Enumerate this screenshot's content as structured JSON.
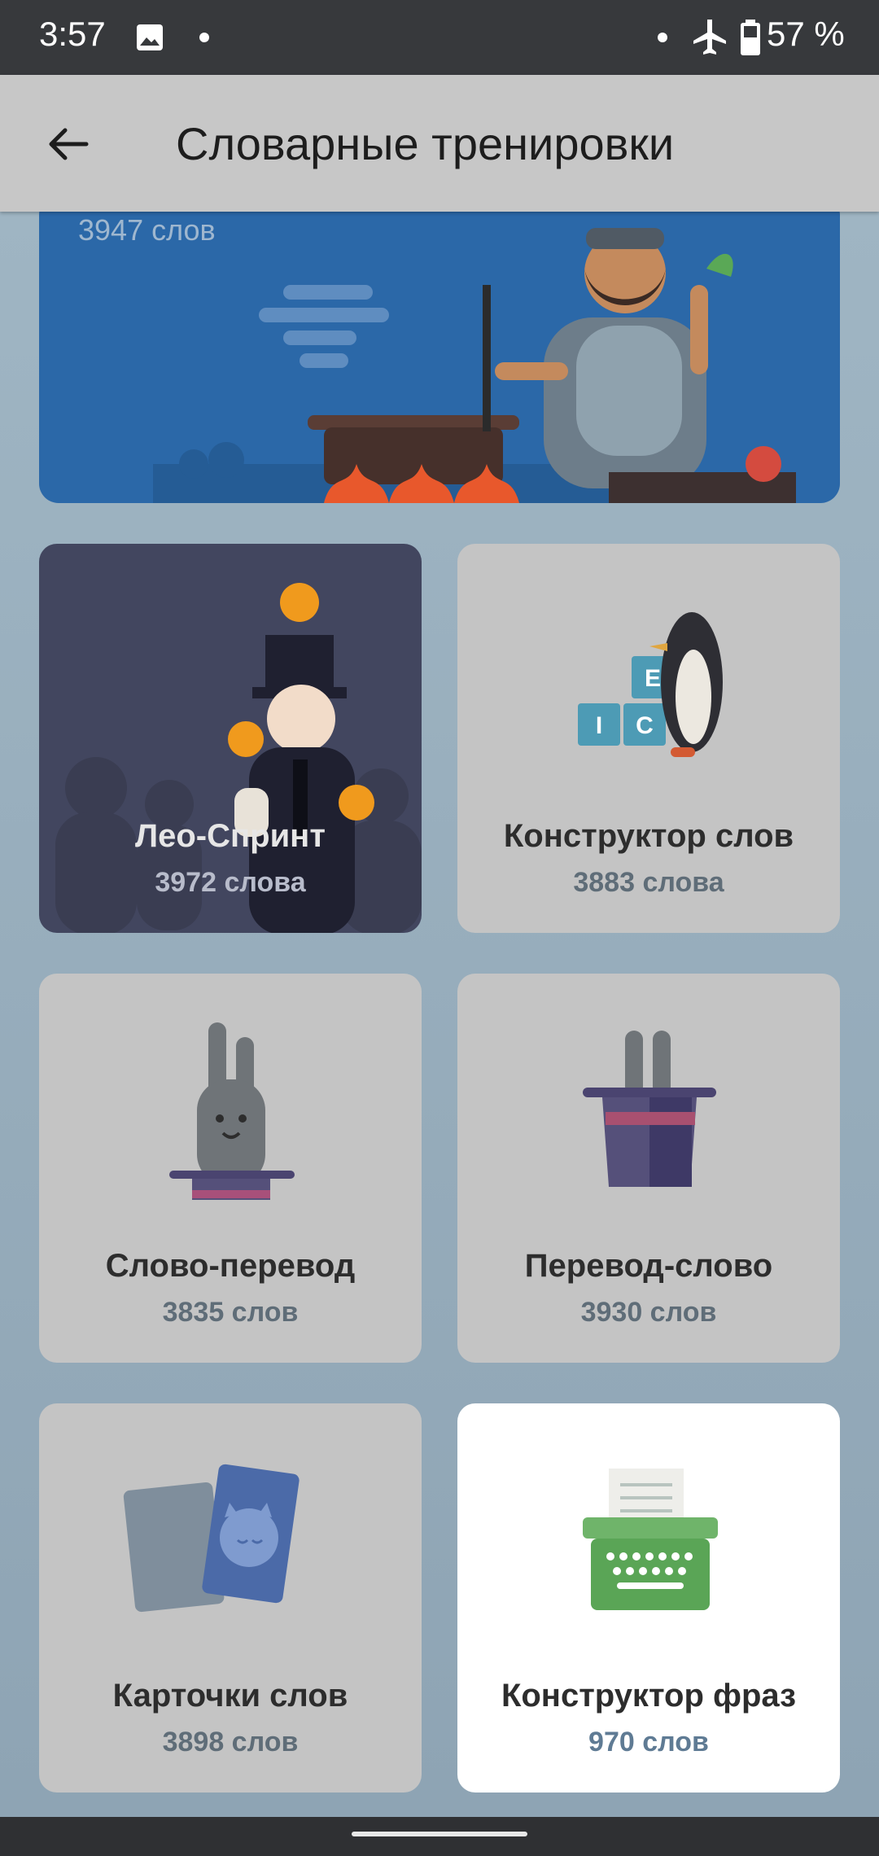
{
  "status_bar": {
    "time": "3:57",
    "battery_percent": "57 %",
    "icons": [
      "image-icon",
      "dot-icon",
      "airplane-mode-icon",
      "battery-icon"
    ]
  },
  "app_bar": {
    "title": "Словарные тренировки",
    "back_icon": "back-arrow-icon"
  },
  "banner": {
    "count": "3947 слов"
  },
  "cards": [
    {
      "label": "Лео-Спринт",
      "count": "3972 слова"
    },
    {
      "label": "Конструктор слов",
      "count": "3883 слова"
    },
    {
      "label": "Слово-перевод",
      "count": "3835 слов"
    },
    {
      "label": "Перевод-слово",
      "count": "3930 слов"
    },
    {
      "label": "Карточки слов",
      "count": "3898 слов"
    },
    {
      "label": "Конструктор фраз",
      "count": "970 слов"
    }
  ],
  "colors": {
    "banner": "#2b68a8",
    "card_dim": "#c4c4c4",
    "card_dark": "#42465f",
    "card_active": "#ffffff",
    "status_bar": "#37393c",
    "app_bar": "#c7c7c7"
  }
}
